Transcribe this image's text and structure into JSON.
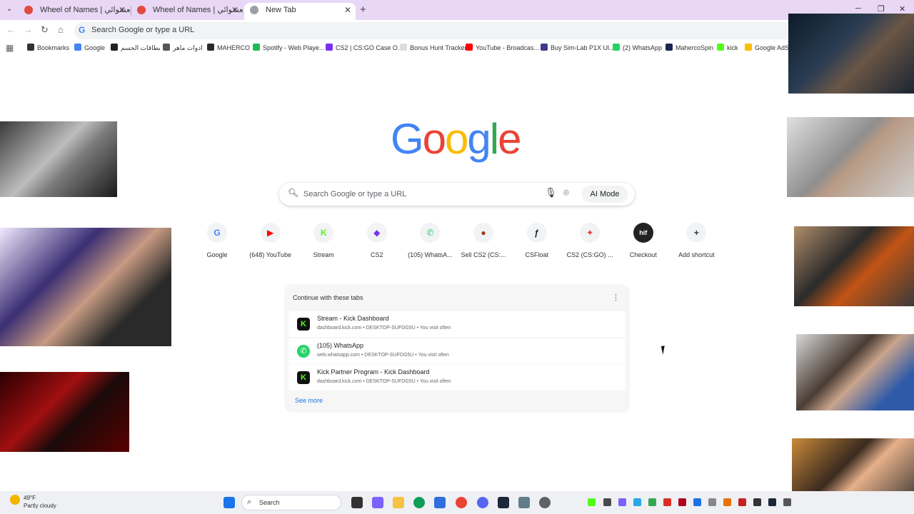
{
  "tabs": [
    {
      "label": "Wheel of Names | قسم العشوائي",
      "active": false
    },
    {
      "label": "Wheel of Names | قسم العشوائي",
      "active": false
    },
    {
      "label": "New Tab",
      "active": true
    }
  ],
  "toolbar": {
    "omnibox_placeholder": "Search Google or type a URL"
  },
  "bookmarks": [
    {
      "label": "Bookmarks",
      "color": "#333333"
    },
    {
      "label": "Google",
      "color": "#4285f4"
    },
    {
      "label": "بطاقات الحسم",
      "color": "#222222"
    },
    {
      "label": "ادوات ماهر",
      "color": "#555555"
    },
    {
      "label": "MAHERCO",
      "color": "#2b2b2b"
    },
    {
      "label": "Spotify - Web Playe...",
      "color": "#1db954"
    },
    {
      "label": "CS2 | CS:GO Case O...",
      "color": "#7b2ff7"
    },
    {
      "label": "Bonus Hunt Tracker",
      "color": "#dddddd"
    },
    {
      "label": "YouTube - Broadcas...",
      "color": "#ff0000"
    },
    {
      "label": "Buy Sim-Lab P1X Ul...",
      "color": "#3c3c8c"
    },
    {
      "label": "(2) WhatsApp",
      "color": "#25d366"
    },
    {
      "label": "MahercoSpin",
      "color": "#1c2350"
    },
    {
      "label": "kick",
      "color": "#53fc18"
    },
    {
      "label": "Google AdSe",
      "color": "#fbbc04"
    }
  ],
  "search": {
    "placeholder": "Search Google or type a URL",
    "ai_mode_label": "AI Mode"
  },
  "logo_letters": [
    "G",
    "o",
    "o",
    "g",
    "l",
    "e"
  ],
  "logo_colors": [
    "#4285f4",
    "#ea4335",
    "#fbbc05",
    "#4285f4",
    "#34a853",
    "#ea4335"
  ],
  "shortcuts": [
    {
      "label": "Google",
      "glyph": "G",
      "color": "#4285f4"
    },
    {
      "label": "(648) YouTube",
      "glyph": "▶",
      "color": "#ff0000"
    },
    {
      "label": "Stream",
      "glyph": "K",
      "color": "#53fc18"
    },
    {
      "label": "CS2",
      "glyph": "◆",
      "color": "#7b2ff7"
    },
    {
      "label": "(105) WhatsA...",
      "glyph": "✆",
      "color": "#25d366"
    },
    {
      "label": "Sell CS2 (CS:...",
      "glyph": "●",
      "color": "#a33b1c"
    },
    {
      "label": "CSFloat",
      "glyph": "ƒ",
      "color": "#222222"
    },
    {
      "label": "CS2 (CS:GO) ...",
      "glyph": "✦",
      "color": "#e53935"
    },
    {
      "label": "Checkout",
      "glyph": "hif",
      "color": "#ffffff"
    },
    {
      "label": "Add shortcut",
      "glyph": "+",
      "color": "#333333"
    }
  ],
  "continue": {
    "title": "Continue with these tabs",
    "items": [
      {
        "name": "Stream - Kick Dashboard",
        "sub": "dashboard.kick.com • DESKTOP-SUFDG5U • You visit often",
        "glyph": "K",
        "color": "#53fc18"
      },
      {
        "name": "(105) WhatsApp",
        "sub": "web.whatsapp.com • DESKTOP-SUFDG5U • You visit often",
        "glyph": "✆",
        "color": "#25d366"
      },
      {
        "name": "Kick Partner Program - Kick Dashboard",
        "sub": "dashboard.kick.com • DESKTOP-SUFDG5U • You visit often",
        "glyph": "K",
        "color": "#53fc18"
      }
    ],
    "see_more": "See more"
  },
  "taskbar": {
    "temperature": "49°F",
    "condition": "Partly cloudy",
    "search_label": "Search"
  }
}
